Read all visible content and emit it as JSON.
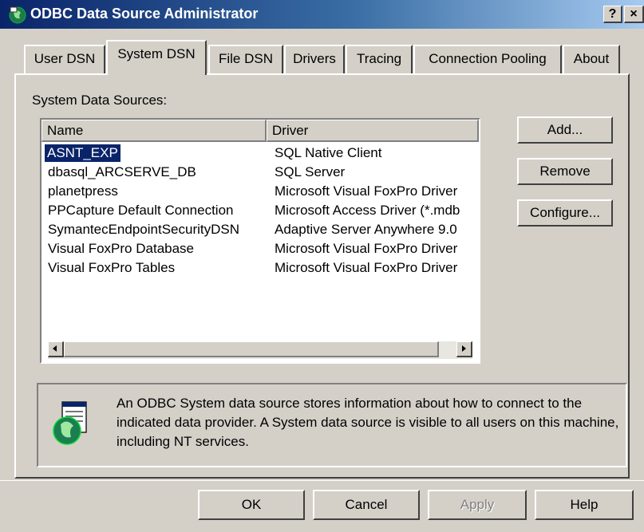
{
  "window": {
    "title": "ODBC Data Source Administrator",
    "help_button": "?",
    "close_button": "×"
  },
  "tabs": [
    "User DSN",
    "System DSN",
    "File DSN",
    "Drivers",
    "Tracing",
    "Connection Pooling",
    "About"
  ],
  "active_tab": "System DSN",
  "list": {
    "label": "System Data Sources:",
    "columns": [
      "Name",
      "Driver"
    ],
    "rows": [
      {
        "name": "ASNT_EXP",
        "driver": "SQL Native Client",
        "selected": true
      },
      {
        "name": "dbasql_ARCSERVE_DB",
        "driver": "SQL Server"
      },
      {
        "name": "planetpress",
        "driver": "Microsoft Visual FoxPro Driver"
      },
      {
        "name": "PPCapture Default Connection",
        "driver": "Microsoft Access Driver (*.mdb"
      },
      {
        "name": "SymantecEndpointSecurityDSN",
        "driver": "Adaptive Server Anywhere 9.0"
      },
      {
        "name": "Visual FoxPro Database",
        "driver": "Microsoft Visual FoxPro Driver"
      },
      {
        "name": "Visual FoxPro Tables",
        "driver": "Microsoft Visual FoxPro Driver"
      }
    ]
  },
  "side_buttons": {
    "add": "Add...",
    "remove": "Remove",
    "configure": "Configure..."
  },
  "info_text": "An ODBC System data source stores information about how to connect to the indicated data provider.  A System data source is visible to all users on this machine, including NT services.",
  "footer_buttons": {
    "ok": "OK",
    "cancel": "Cancel",
    "apply": "Apply",
    "help": "Help"
  },
  "colors": {
    "dialog_bg": "#d4d0c8",
    "title_start": "#0a246a",
    "title_end": "#a6caf0",
    "selection": "#0a246a",
    "disabled_text": "#808080"
  }
}
